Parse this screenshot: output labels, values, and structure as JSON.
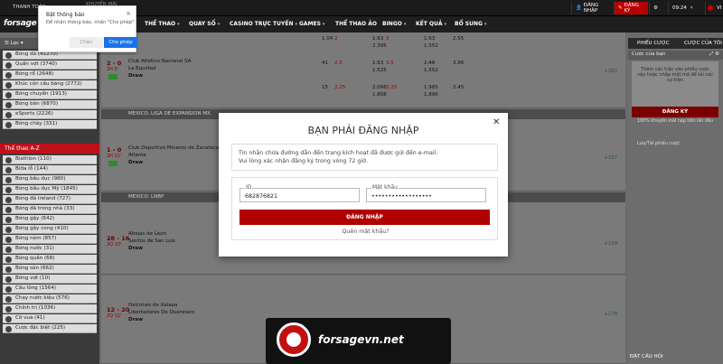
{
  "topbar": {
    "left_text": "THANH TOÁN",
    "promo": "KHUYẾN MÃI",
    "login_label": "ĐĂNG NHẬP",
    "register_label": "ĐĂNG KÝ",
    "time": "09:24",
    "lang": "VI",
    "flag_color": "#d00000"
  },
  "nav": {
    "logo": "forsage",
    "items": [
      "THỂ THAO",
      "QUAY SỐ",
      "CASINO TRỰC TUYẾN",
      "GAMES",
      "THỂ THAO ẢO",
      "BINGO",
      "KẾT QUẢ",
      "BỔ SUNG"
    ]
  },
  "notification": {
    "title": "Bật thông báo",
    "subtitle": "Để nhận thông báo, nhấn \"Cho phép\"",
    "deny": "Chặn",
    "allow": "Cho phép"
  },
  "sidebar": {
    "filter": "Lọc",
    "sports": [
      {
        "label": "Bóng đá (41270)",
        "icon": "football-icon"
      },
      {
        "label": "Quần vợt (3740)",
        "icon": "tennis-icon"
      },
      {
        "label": "Bóng rổ (2648)",
        "icon": "basketball-icon"
      },
      {
        "label": "Khúc côn cầu băng (2772)",
        "icon": "ice-hockey-icon"
      },
      {
        "label": "Bóng chuyền (1913)",
        "icon": "volleyball-icon"
      },
      {
        "label": "Bóng bàn (6870)",
        "icon": "table-tennis-icon"
      },
      {
        "label": "eSports (2226)",
        "icon": "esports-icon"
      },
      {
        "label": "Bóng chày (331)",
        "icon": "baseball-icon"
      }
    ],
    "az_label": "Thể thao A-Z",
    "sports_az": [
      {
        "label": "Biathlon (110)",
        "icon": "biathlon-icon"
      },
      {
        "label": "Bida lỗ (144)",
        "icon": "billiards-icon"
      },
      {
        "label": "Bóng bầu dục (980)",
        "icon": "rugby-icon"
      },
      {
        "label": "Bóng bầu dục Mỹ (1845)",
        "icon": "american-football-icon"
      },
      {
        "label": "Bóng đá Ireland (727)",
        "icon": "gaelic-football-icon"
      },
      {
        "label": "Bóng đá trong nhà (33)",
        "icon": "futsal-icon"
      },
      {
        "label": "Bóng gậy (642)",
        "icon": "cricket-icon"
      },
      {
        "label": "Bóng gậy cong (410)",
        "icon": "hurling-icon"
      },
      {
        "label": "Bóng ném (857)",
        "icon": "handball-icon"
      },
      {
        "label": "Bóng nước (31)",
        "icon": "water-polo-icon"
      },
      {
        "label": "Bóng quần (68)",
        "icon": "squash-icon"
      },
      {
        "label": "Bóng sàn (662)",
        "icon": "floorball-icon"
      },
      {
        "label": "Bóng vợt (10)",
        "icon": "lacrosse-icon"
      },
      {
        "label": "Cầu lông (1564)",
        "icon": "badminton-icon"
      },
      {
        "label": "Chạy nước kiệu (576)",
        "icon": "trotting-icon"
      },
      {
        "label": "Chính trị (1036)",
        "icon": "politics-icon"
      },
      {
        "label": "Cờ vua (41)",
        "icon": "chess-icon"
      },
      {
        "label": "Cược đặc biệt (225)",
        "icon": "special-bets-icon"
      }
    ]
  },
  "matches": [
    {
      "score": "2 - 0",
      "minute": "2H 0'",
      "team1": "Club Atletico Nacional SA",
      "team2": "La Equidad",
      "draw": "Draw",
      "more": "+392"
    },
    {
      "score": "1 - 0",
      "minute": "2H 11'",
      "team1": "Club Deportivo Mineros de Zacatecas",
      "team2": "Atlante",
      "draw": "Draw",
      "more": "+297"
    },
    {
      "score": "28 - 16",
      "minute": "2Q 10'",
      "team1": "Abejas de Leon",
      "team2": "Santos de San Luis",
      "draw": "Draw",
      "more": "+199"
    },
    {
      "score": "12 - 20",
      "minute": "2Q 11'",
      "team1": "Halcones de Xalapa",
      "team2": "Libertadores De Queretaro",
      "draw": "Draw",
      "more": "+278"
    }
  ],
  "leagues": [
    "MEXICO. LIGA DE EXPANSION MX",
    "MEXICO. LNBP"
  ],
  "odds_rows": [
    [
      "1.04",
      "2",
      "1.63",
      "3",
      "1.63",
      "2.55"
    ],
    [
      "2.395",
      "U",
      "1.552",
      "",
      "",
      ""
    ],
    [
      "41",
      "2.5",
      "1.63",
      "3.5",
      "T",
      "2.48",
      "3.96"
    ],
    [
      "1.525",
      "O",
      "1.552",
      "",
      "",
      ""
    ],
    [
      "15",
      "2.25",
      "2.096",
      "3.25",
      "1.985",
      "2.45"
    ],
    [
      "1.808",
      "O",
      "1.896",
      "",
      "",
      ""
    ]
  ],
  "right_panel": {
    "tab1": "PHIẾU CƯỢC",
    "tab2": "CƯỢC CỦA TÔI",
    "section": "Cược của bạn",
    "empty": "Thêm các trận vào phiếu cược này hoặc nhập một mã để tải các sự kiện",
    "register": "ĐĂNG KÝ",
    "bonus": "100% khuyến mãi nạp tiền lần đầu",
    "save": "Lưu/Tải phiếu cược"
  },
  "modal": {
    "title": "BẠN PHẢI ĐĂNG NHẬP",
    "info1": "Tin nhắn chứa đường dẫn đến trang kích hoạt đã được gửi đến e-mail.",
    "info2": "Vui lòng xác nhận đăng ký trong vòng 72 giờ.",
    "id_label": "ID",
    "id_value": "682876821",
    "password_label": "Mật khẩu",
    "password_value": "••••••••••••••••••",
    "login": "ĐĂNG NHẬP",
    "forgot": "Quên mật khẩu?"
  },
  "banner": {
    "text": "forsagevn.net"
  },
  "ask": "ĐẶT CÂU HỎI"
}
